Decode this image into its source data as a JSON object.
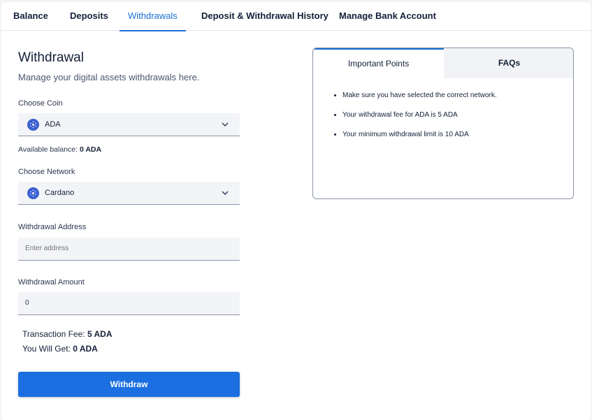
{
  "tabs": [
    {
      "label": "Balance"
    },
    {
      "label": "Deposits"
    },
    {
      "label": "Withdrawals"
    },
    {
      "label": "Deposit & Withdrawal History"
    },
    {
      "label": "Manage Bank Account"
    }
  ],
  "form": {
    "title": "Withdrawal",
    "subtitle": "Manage your digital assets withdrawals here.",
    "coin_label": "Choose Coin",
    "coin_value": "ADA",
    "available_label": "Available balance:",
    "available_value": "0 ADA",
    "network_label": "Choose Network",
    "network_value": "Cardano",
    "address_label": "Withdrawal Address",
    "address_placeholder": "Enter address",
    "amount_label": "Withdrawal Amount",
    "amount_value": "0",
    "fee_label": "Transaction Fee:",
    "fee_value": "5 ADA",
    "get_label": "You Will Get:",
    "get_value": "0 ADA",
    "withdraw_button": "Withdraw"
  },
  "info": {
    "tab_points": "Important Points",
    "tab_faqs": "FAQs",
    "points": [
      "Make sure you have selected the correct network.",
      "Your withdrawal fee for ADA is 5 ADA",
      "Your minimum withdrawal limit is 10 ADA"
    ]
  },
  "colors": {
    "accent": "#1b6fd6",
    "button": "#1b6fe0",
    "coin_icon": "#3a5fd0"
  },
  "icons": {
    "coin": "cardano-icon",
    "dropdown": "chevron-down-icon"
  }
}
